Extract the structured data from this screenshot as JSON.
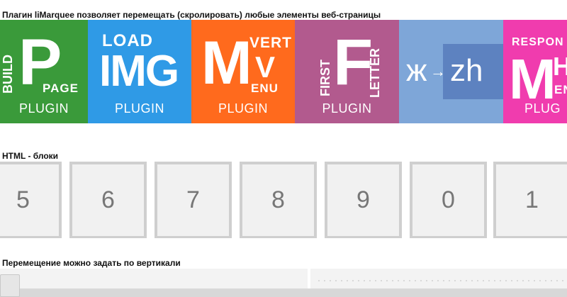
{
  "headings": {
    "plugins": "Плагин liMarquee позволяет перемещать (скролировать) любые элементы веб-страницы",
    "html_blocks": "HTML - блоки",
    "vertical": "Перемещение можно задать по вертикали"
  },
  "plugin_tiles": {
    "build_page": {
      "vertical": "BUILD",
      "big": "P",
      "small": "PAGE",
      "footer": "PLUGIN"
    },
    "load_img": {
      "top": "LOAD",
      "big": "IMG",
      "footer": "PLUGIN"
    },
    "mvm": {
      "big": "M",
      "top": "VERT",
      "mid": "V",
      "small": "ENU",
      "footer": "PLUGIN"
    },
    "first_letter": {
      "vertical1": "FIRST",
      "big": "F",
      "vertical2": "LETTER",
      "footer": "PLUGIN"
    },
    "translit": {
      "left": "ж",
      "arrow": "→",
      "right": "zh"
    },
    "responsive": {
      "top": "RESPON",
      "big": "M",
      "side": "HA",
      "small": "ENU",
      "footer": "PLUG"
    }
  },
  "colors": {
    "green": "#3a9a3a",
    "blue": "#2f9ae6",
    "orange": "#ff6a1d",
    "purple": "#b25a8e",
    "lightblue": "#7ea6d8",
    "pink": "#f03cae"
  },
  "html_blocks": [
    "5",
    "6",
    "7",
    "8",
    "9",
    "0",
    "1"
  ]
}
